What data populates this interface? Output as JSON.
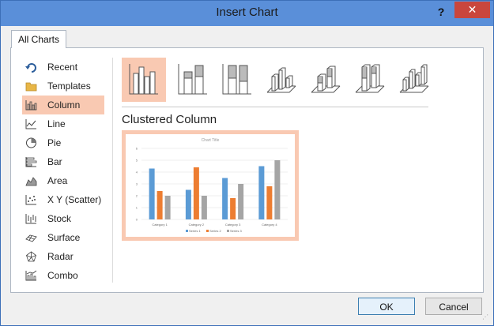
{
  "window": {
    "title": "Insert Chart",
    "help": "?",
    "close": "✕"
  },
  "tabs": [
    {
      "label": "All Charts"
    }
  ],
  "categories": [
    {
      "label": "Recent",
      "icon": "recent-icon"
    },
    {
      "label": "Templates",
      "icon": "folder-icon"
    },
    {
      "label": "Column",
      "icon": "column-chart-icon",
      "selected": true
    },
    {
      "label": "Line",
      "icon": "line-chart-icon"
    },
    {
      "label": "Pie",
      "icon": "pie-chart-icon"
    },
    {
      "label": "Bar",
      "icon": "bar-chart-icon"
    },
    {
      "label": "Area",
      "icon": "area-chart-icon"
    },
    {
      "label": "X Y (Scatter)",
      "icon": "scatter-chart-icon"
    },
    {
      "label": "Stock",
      "icon": "stock-chart-icon"
    },
    {
      "label": "Surface",
      "icon": "surface-chart-icon"
    },
    {
      "label": "Radar",
      "icon": "radar-chart-icon"
    },
    {
      "label": "Combo",
      "icon": "combo-chart-icon"
    }
  ],
  "subtypes": [
    {
      "icon": "clustered-column-icon",
      "selected": true
    },
    {
      "icon": "stacked-column-icon"
    },
    {
      "icon": "100-stacked-column-icon"
    },
    {
      "icon": "3d-clustered-column-icon"
    },
    {
      "icon": "3d-stacked-column-icon"
    },
    {
      "icon": "3d-100-stacked-column-icon"
    },
    {
      "icon": "3d-column-icon"
    }
  ],
  "selected_subtype_title": "Clustered Column",
  "preview": {
    "title": "Chart Title",
    "categories": [
      "Category 1",
      "Category 2",
      "Category 3",
      "Category 4"
    ],
    "legend": [
      "Series 1",
      "Series 2",
      "Series 3"
    ],
    "series_colors": [
      "#5b9bd5",
      "#ed7d31",
      "#a5a5a5"
    ]
  },
  "chart_data": {
    "type": "bar",
    "title": "Chart Title",
    "categories": [
      "Category 1",
      "Category 2",
      "Category 3",
      "Category 4"
    ],
    "series": [
      {
        "name": "Series 1",
        "values": [
          4.3,
          2.5,
          3.5,
          4.5
        ]
      },
      {
        "name": "Series 2",
        "values": [
          2.4,
          4.4,
          1.8,
          2.8
        ]
      },
      {
        "name": "Series 3",
        "values": [
          2,
          2,
          3,
          5
        ]
      }
    ],
    "ylim": [
      0,
      6
    ],
    "yticks": [
      0,
      1,
      2,
      3,
      4,
      5,
      6
    ],
    "grid": true,
    "legend": "bottom"
  },
  "buttons": {
    "ok": "OK",
    "cancel": "Cancel"
  },
  "colors": {
    "titlebar": "#5a8fd9",
    "selection": "#f9c9b2",
    "close": "#c9463d"
  }
}
